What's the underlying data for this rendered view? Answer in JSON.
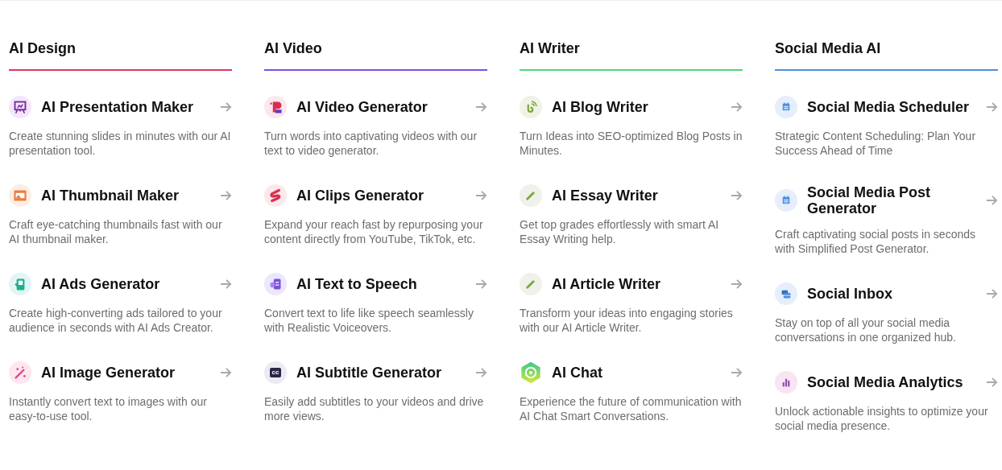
{
  "columns": [
    {
      "heading": "AI Design",
      "color": "#d63a5c",
      "items": [
        {
          "title": "AI Presentation Maker",
          "description": "Create stunning slides in minutes with our AI presentation tool."
        },
        {
          "title": "AI Thumbnail Maker",
          "description": "Craft eye-catching thumbnails fast with our AI thumbnail maker."
        },
        {
          "title": "AI Ads Generator",
          "description": "Create high-converting ads tailored to your audience in seconds with AI Ads Creator."
        },
        {
          "title": "AI Image Generator",
          "description": "Instantly convert text to images with our easy-to-use tool."
        }
      ]
    },
    {
      "heading": "AI Video",
      "color": "#7c4fe0",
      "items": [
        {
          "title": "AI Video Generator",
          "description": "Turn words into captivating videos with our text to video generator."
        },
        {
          "title": "AI Clips Generator",
          "description": "Expand your reach fast by repurposing your content directly from YouTube, TikTok, etc."
        },
        {
          "title": "AI Text to Speech",
          "description": "Convert text to life like speech seamlessly with Realistic Voiceovers."
        },
        {
          "title": "AI Subtitle Generator",
          "icon_text": "cc",
          "description": "Easily add subtitles to your videos and drive more views."
        }
      ]
    },
    {
      "heading": "AI Writer",
      "color": "#4fd47c",
      "items": [
        {
          "title": "AI Blog Writer",
          "description": "Turn Ideas into SEO-optimized Blog Posts in Minutes."
        },
        {
          "title": "AI Essay Writer",
          "description": "Get top grades effortlessly with smart AI Essay Writing help."
        },
        {
          "title": "AI Article Writer",
          "description": "Transform your ideas into engaging stories with our AI Article Writer."
        },
        {
          "title": "AI Chat",
          "description": "Experience the future of communication with AI Chat Smart Conversations."
        }
      ]
    },
    {
      "heading": "Social Media AI",
      "color": "#4a8fe2",
      "items": [
        {
          "title": "Social Media Scheduler",
          "description": "Strategic Content Scheduling: Plan Your Success Ahead of Time"
        },
        {
          "title": "Social Media Post Generator",
          "description": "Craft captivating social posts in seconds with Simplified Post Generator."
        },
        {
          "title": "Social Inbox",
          "description": "Stay on top of all your social media conversations in one organized hub."
        },
        {
          "title": "Social Media Analytics",
          "description": "Unlock actionable insights to optimize your social media presence."
        }
      ]
    }
  ]
}
